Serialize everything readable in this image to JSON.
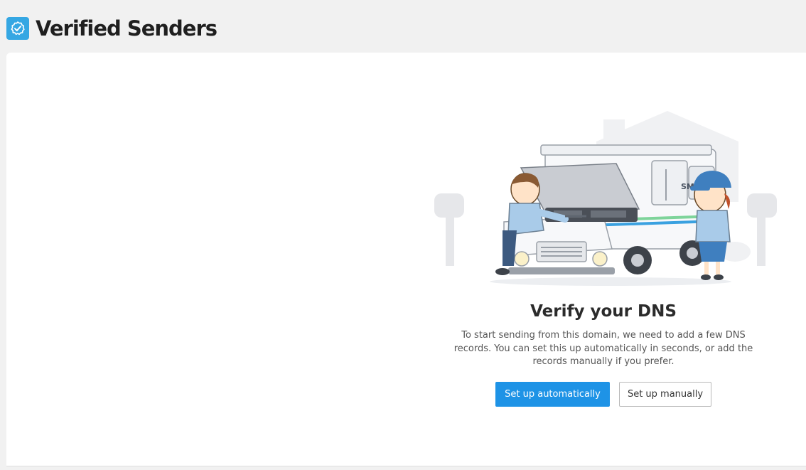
{
  "header": {
    "title": "Verified Senders",
    "icon": "verified-badge-icon",
    "icon_color": "#35a7e3"
  },
  "empty_state": {
    "illustration": "mechanics-fixing-smtp-van-illustration",
    "van_label": "SMTP",
    "title": "Verify your DNS",
    "description": "To start sending from this domain, we need to add a few DNS records. You can set this up automatically in seconds, or add the records manually if you prefer.",
    "primary_button": "Set up automatically",
    "secondary_button": "Set up manually"
  },
  "colors": {
    "primary": "#1e93e6",
    "background": "#f1f1f1",
    "card": "#ffffff"
  }
}
